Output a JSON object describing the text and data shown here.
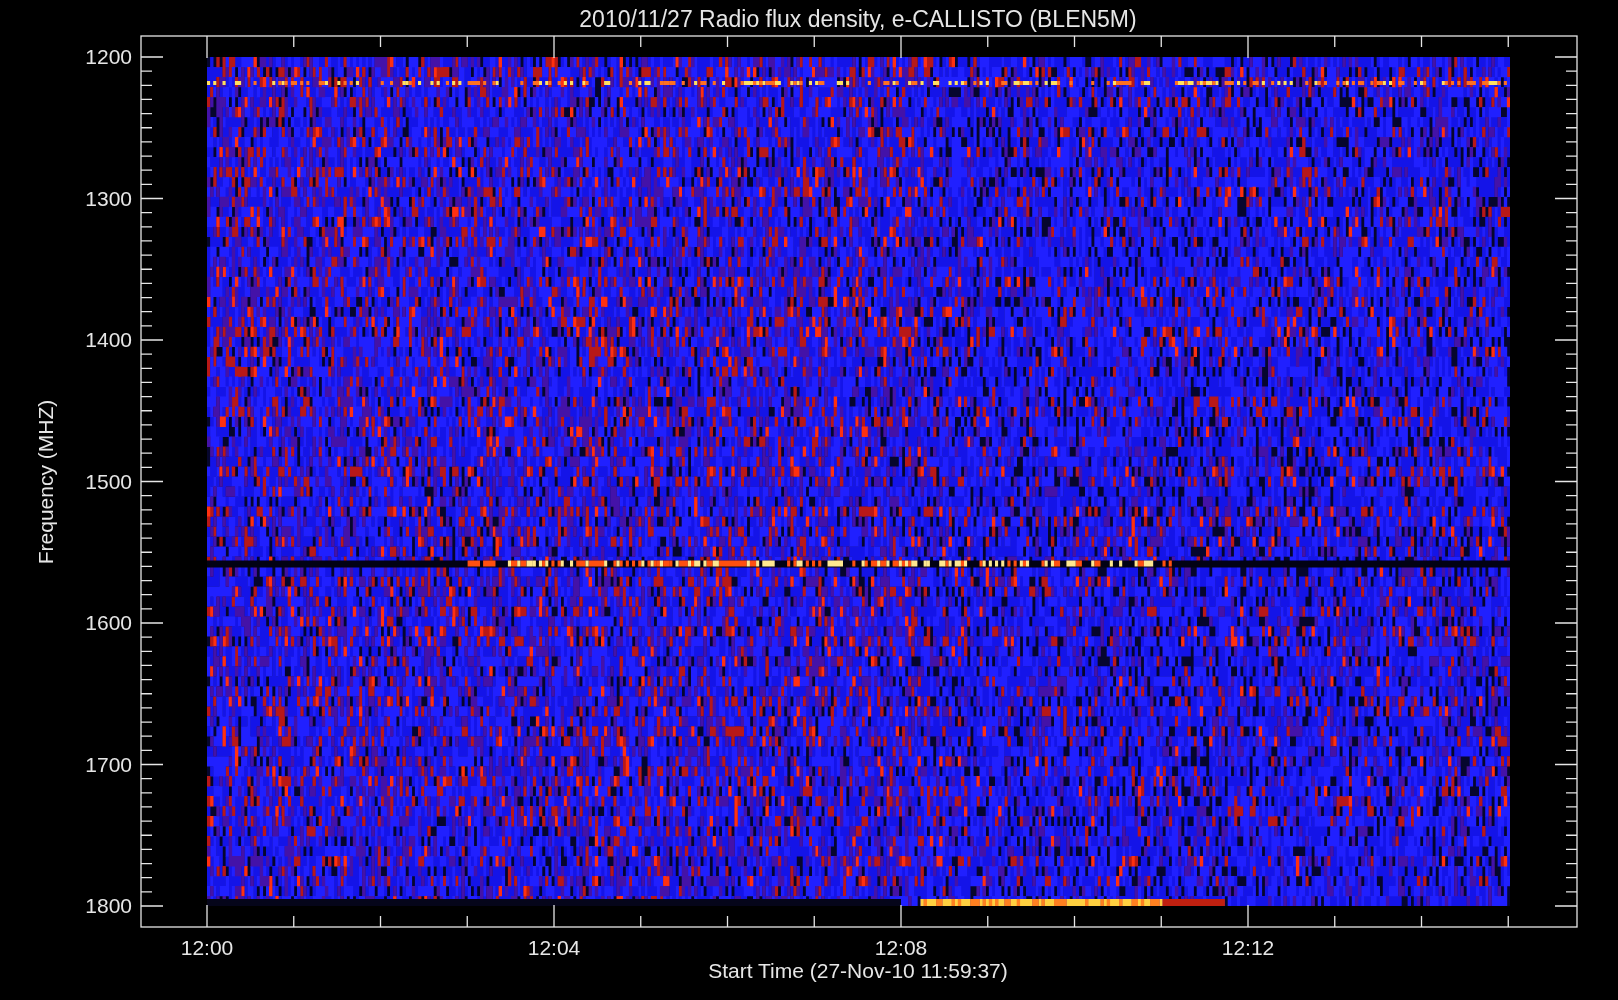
{
  "title": "2010/11/27  Radio flux density, e-CALLISTO (BLEN5M)",
  "y_axis": {
    "label": "Frequency (MHZ)",
    "ticks": [
      "1200",
      "1300",
      "1400",
      "1500",
      "1600",
      "1700",
      "1800"
    ]
  },
  "x_axis": {
    "label": "Start Time (27-Nov-10 11:59:37)",
    "ticks": [
      "12:00",
      "12:04",
      "12:08",
      "12:12"
    ]
  }
}
